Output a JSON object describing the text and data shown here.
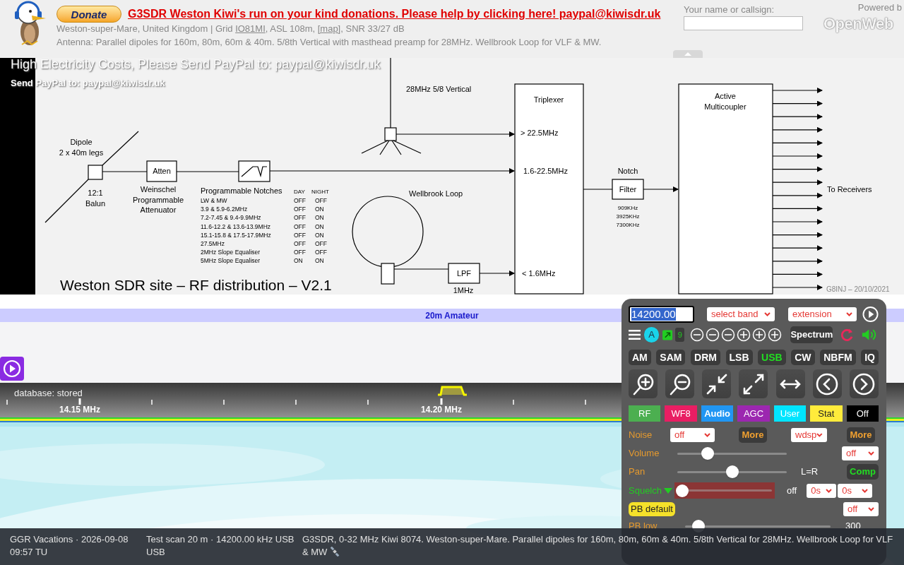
{
  "header": {
    "donate_button": "Donate",
    "donation_link": "G3SDR Weston Kiwi's run on your kind donations. Please help by clicking here! paypal@kiwisdr.uk",
    "location_line": [
      {
        "kind": "text",
        "text": "Weston-super-Mare, United Kingdom | Grid "
      },
      {
        "kind": "link",
        "text": "IO81MI"
      },
      {
        "kind": "text",
        "text": ", ASL 108m, "
      },
      {
        "kind": "link",
        "text": "[map]"
      },
      {
        "kind": "text",
        "text": ", SNR 33/27 dB"
      }
    ],
    "antenna_line": "Antenna: Parallel dipoles for 160m, 80m, 60m & 40m. 5/8th Vertical with masthead preamp for 28MHz. Wellbrook Loop for VLF & MW.",
    "callsign": {
      "label": "Your name or callsign:"
    },
    "powered_by": "Powered b",
    "logo_text": "OpenWeb"
  },
  "banner": {
    "title": "High Electricity Costs, Please Send PayPal to: paypal@kiwisdr.uk",
    "subtitle": "Send PayPal to: paypal@kiwisdr.uk"
  },
  "diagram": {
    "vertical_label": "28MHz 5/8 Vertical",
    "dipole_label": [
      "Dipole",
      "2 x 40m legs"
    ],
    "balun_label": [
      "12:1",
      "Balun"
    ],
    "atten_box": "Atten",
    "atten_label": [
      "Weinschel",
      "Programmable",
      "Attenuator"
    ],
    "notches": {
      "title": "Programmable Notches",
      "day": "DAY",
      "night": "NIGHT",
      "rows": [
        {
          "band": "LW & MW",
          "day": "OFF",
          "night": "OFF"
        },
        {
          "band": "3.9 & 5.9-6.2MHz",
          "day": "OFF",
          "night": "ON"
        },
        {
          "band": "7.2-7.45 & 9.4-9.9MHz",
          "day": "OFF",
          "night": "ON"
        },
        {
          "band": "11.6-12.2 & 13.6-13.9MHz",
          "day": "OFF",
          "night": "ON"
        },
        {
          "band": "15.1-15.8 & 17.5-17.9MHz",
          "day": "OFF",
          "night": "ON"
        },
        {
          "band": "27.5MHz",
          "day": "OFF",
          "night": "OFF"
        },
        {
          "band": "2MHz  Slope Equaliser",
          "day": "OFF",
          "night": "OFF"
        },
        {
          "band": "5MHz  Slope Equaliser",
          "day": "ON",
          "night": "ON"
        }
      ]
    },
    "loop_label": "Wellbrook Loop",
    "lpf_box": "LPF",
    "lpf_label": "1MHz",
    "triplexer": {
      "title": "Triplexer",
      "ports": [
        "> 22.5MHz",
        "1.6-22.5MHz",
        "< 1.6MHz"
      ]
    },
    "notch_filter": {
      "title": "Notch",
      "box": "Filter",
      "frequencies": [
        "909KHz",
        "3925KHz",
        "7300KHz"
      ]
    },
    "multicoupler": [
      "Active",
      "Multicoupler"
    ],
    "output_label": "To Receivers",
    "caption": "Weston SDR site – RF distribution – V2.1",
    "credit": "G8INJ – 20/10/2021"
  },
  "band_bar": {
    "label": "20m Amateur"
  },
  "scale": {
    "status": "database: stored",
    "labels": [
      "14.15 MHz",
      "14.20 MHz"
    ]
  },
  "panel": {
    "frequency": "14200.00",
    "band_select": "select band",
    "extension_select": "extension",
    "toolbar": {
      "badge": "A",
      "count": "9",
      "spectrum": "Spectrum"
    },
    "modes": [
      {
        "label": "AM",
        "selected": false
      },
      {
        "label": "SAM",
        "selected": false
      },
      {
        "label": "DRM",
        "selected": false
      },
      {
        "label": "LSB",
        "selected": false
      },
      {
        "label": "USB",
        "selected": true
      },
      {
        "label": "CW",
        "selected": false
      },
      {
        "label": "NBFM",
        "selected": false
      },
      {
        "label": "IQ",
        "selected": false
      }
    ],
    "tabs": [
      {
        "label": "RF",
        "color": "#4caf50",
        "selected": false
      },
      {
        "label": "WF8",
        "color": "#e91e63",
        "selected": false
      },
      {
        "label": "Audio",
        "color": "#2196f3",
        "selected": true
      },
      {
        "label": "AGC",
        "color": "#9c27b0",
        "selected": false
      },
      {
        "label": "User",
        "color": "#00e5ff",
        "selected": false
      },
      {
        "label": "Stat",
        "color": "#ffeb3b",
        "selected": false
      },
      {
        "label": "Off",
        "color": "#000000",
        "selected": false
      }
    ],
    "noise": {
      "label": "Noise",
      "select": "off",
      "more": "More",
      "filter": "wdsp",
      "more_2": "More"
    },
    "volume": {
      "label": "Volume",
      "level": 0.28,
      "select": "off"
    },
    "pan": {
      "label": "Pan",
      "level": 0.5,
      "reading": "L=R",
      "comp": "Comp"
    },
    "squelch": {
      "label": "Squelch",
      "level": 0.05,
      "reading": "off",
      "select_1": "0s",
      "select_2": "0s"
    },
    "pb_default": {
      "button": "PB default",
      "select": "off"
    },
    "pb_low": {
      "label": "PB low",
      "level": 0.09,
      "reading": "300"
    }
  },
  "status_bar": {
    "schedule": "GGR Vacations · 2026-09-08 09:57 TU",
    "scan": "Test scan 20 m · 14200.00 kHz USB USB",
    "info": "G3SDR, 0-32 MHz Kiwi 8074. Weston-super-Mare. Parallel dipoles for 160m, 80m, 60m & 40m. 5/8th Vertical for 28MHz. Wellbrook Loop for VLF & MW"
  }
}
